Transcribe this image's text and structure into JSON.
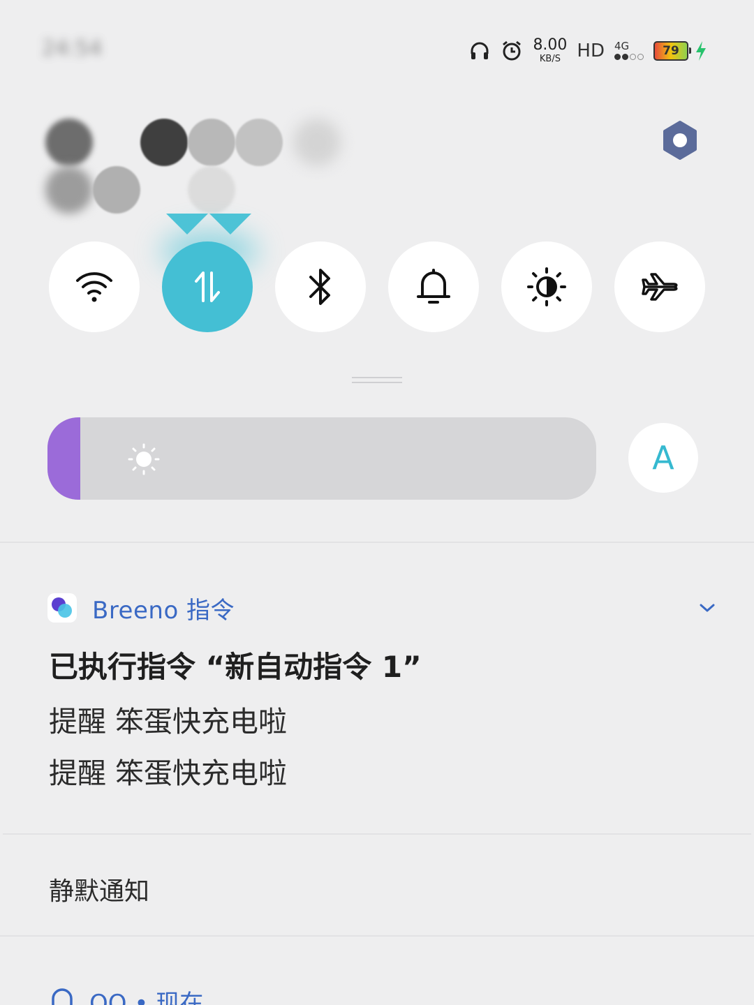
{
  "status_bar": {
    "time": "24:54",
    "net_speed_value": "8.00",
    "net_speed_unit": "KB/S",
    "hd_label": "HD",
    "network_type": "4G",
    "battery_level": "79",
    "icons": [
      "headphones-icon",
      "alarm-icon",
      "signal-icon",
      "battery-icon",
      "charging-bolt-icon"
    ]
  },
  "quick_toggles": [
    {
      "id": "wifi",
      "icon": "wifi-icon",
      "active": false
    },
    {
      "id": "mobile-data",
      "icon": "mobile-data-icon",
      "active": true
    },
    {
      "id": "bluetooth",
      "icon": "bluetooth-icon",
      "active": false
    },
    {
      "id": "ringer",
      "icon": "bell-icon",
      "active": false
    },
    {
      "id": "dark-mode",
      "icon": "brightness-contrast-icon",
      "active": false
    },
    {
      "id": "airplane",
      "icon": "airplane-icon",
      "active": false
    }
  ],
  "brightness": {
    "level_fraction": 0.06,
    "auto_label": "A"
  },
  "colors": {
    "accent": "#44bfd4",
    "brightness_fill": "#9b6bd9",
    "app_name": "#3a69c4",
    "background": "#eeeeef"
  },
  "notification": {
    "app_name": "Breeno 指令",
    "title": "已执行指令 “新自动指令 1”",
    "lines": [
      "提醒 笨蛋快充电啦",
      "提醒 笨蛋快充电啦"
    ]
  },
  "silent_section": {
    "label": "静默通知"
  },
  "next_notification": {
    "app_label": "QQ • 现在"
  }
}
